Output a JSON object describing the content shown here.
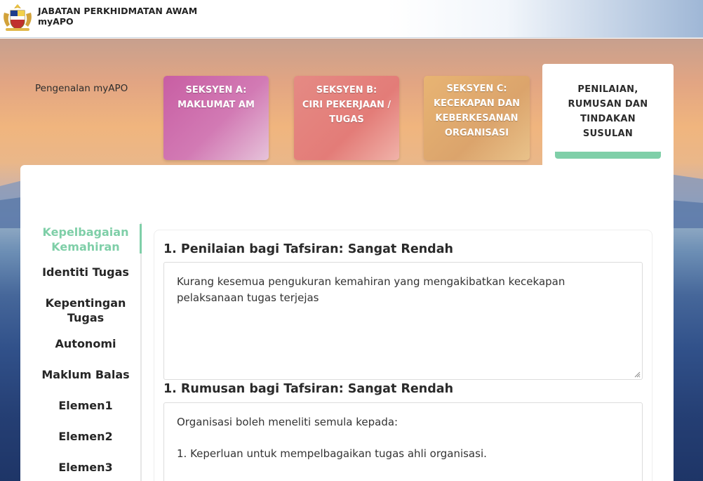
{
  "header": {
    "org_name": "JABATAN PERKHIDMATAN AWAM",
    "app_name": "myAPO",
    "crest_icon": "malaysia-coat-of-arms-icon"
  },
  "tabs": {
    "intro": "Pengenalan myAPO",
    "seksyen_a": [
      "SEKSYEN A:",
      "MAKLUMAT AM"
    ],
    "seksyen_b": [
      "SEKSYEN B:",
      "CIRI PEKERJAAN /",
      "TUGAS"
    ],
    "seksyen_c": [
      "SEKSYEN C:",
      "KECEKAPAN DAN",
      "KEBERKESANAN",
      "ORGANISASI"
    ],
    "penilaian": [
      "PENILAIAN,",
      "RUMUSAN DAN",
      "TINDAKAN",
      "SUSULAN"
    ],
    "active_underline_color": "#7fcfa8"
  },
  "sidebar": {
    "items": [
      {
        "label": [
          "Kepelbagaian",
          "Kemahiran"
        ],
        "active": true
      },
      {
        "label": [
          "Identiti Tugas"
        ],
        "active": false
      },
      {
        "label": [
          "Kepentingan",
          "Tugas"
        ],
        "active": false
      },
      {
        "label": [
          "Autonomi"
        ],
        "active": false
      },
      {
        "label": [
          "Maklum Balas"
        ],
        "active": false
      },
      {
        "label": [
          "Elemen1"
        ],
        "active": false
      },
      {
        "label": [
          "Elemen2"
        ],
        "active": false
      },
      {
        "label": [
          "Elemen3"
        ],
        "active": false
      }
    ],
    "active_color": "#7fcfa8"
  },
  "content": {
    "penilaian_title": "1. Penilaian bagi Tafsiran: Sangat Rendah",
    "penilaian_text": "Kurang kesemua pengukuran kemahiran yang mengakibatkan kecekapan pelaksanaan tugas terjejas",
    "rumusan_title": "1. Rumusan bagi Tafsiran: Sangat Rendah",
    "rumusan_line1": "Organisasi boleh meneliti semula kepada:",
    "rumusan_line2": "1. Keperluan untuk mempelbagaikan tugas ahli organisasi."
  }
}
